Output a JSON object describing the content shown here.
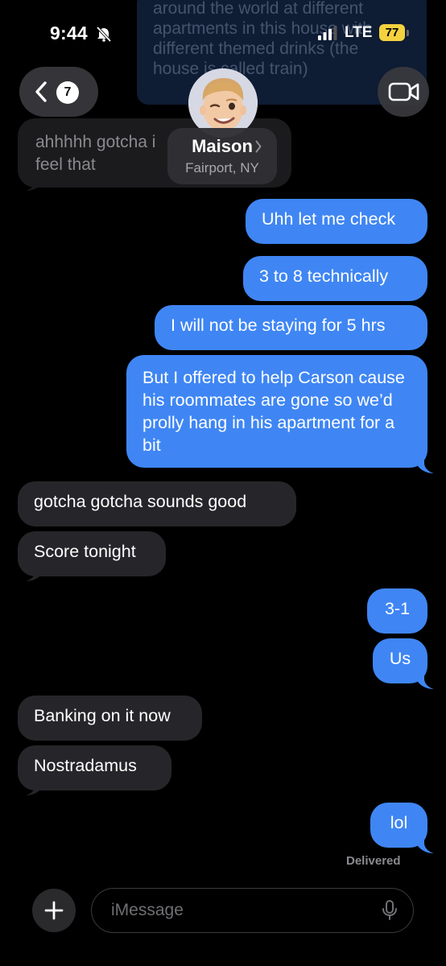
{
  "status_bar": {
    "time": "9:44",
    "carrier": "LTE",
    "battery": "77"
  },
  "background_notification": {
    "text": "around the world at different\napartments in this house with\ndifferent themed drinks (the\nhouse is called train)"
  },
  "header": {
    "unread_count": "7",
    "contact_name": "Maison",
    "contact_location": "Fairport, NY",
    "icons": {
      "back": "chevron-left-icon",
      "video": "video-camera-icon",
      "avatar": "memoji-avatar"
    }
  },
  "messages": [
    {
      "side": "incoming",
      "text": "ahhhhh gotcha i feel that"
    },
    {
      "side": "outgoing",
      "text": "Uhh let me check"
    },
    {
      "side": "outgoing",
      "text": "3 to 8 technically"
    },
    {
      "side": "outgoing",
      "text": "I will not be staying for 5 hrs"
    },
    {
      "side": "outgoing",
      "text": "But I offered to help Carson cause his roommates are gone so we’d prolly hang in his apartment for a bit"
    },
    {
      "side": "incoming",
      "text": "gotcha gotcha sounds good"
    },
    {
      "side": "incoming",
      "text": "Score tonight"
    },
    {
      "side": "outgoing",
      "text": "3-1"
    },
    {
      "side": "outgoing",
      "text": "Us"
    },
    {
      "side": "incoming",
      "text": "Banking on it now"
    },
    {
      "side": "incoming",
      "text": "Nostradamus"
    },
    {
      "side": "outgoing",
      "text": "lol"
    }
  ],
  "delivery_status": "Delivered",
  "composer": {
    "placeholder": "iMessage",
    "icons": {
      "add": "plus-icon",
      "dictate": "microphone-icon"
    }
  },
  "colors": {
    "outgoing_bubble": "#3f86f4",
    "incoming_bubble": "#26262a",
    "background": "#000000",
    "battery": "#f4d23e"
  }
}
